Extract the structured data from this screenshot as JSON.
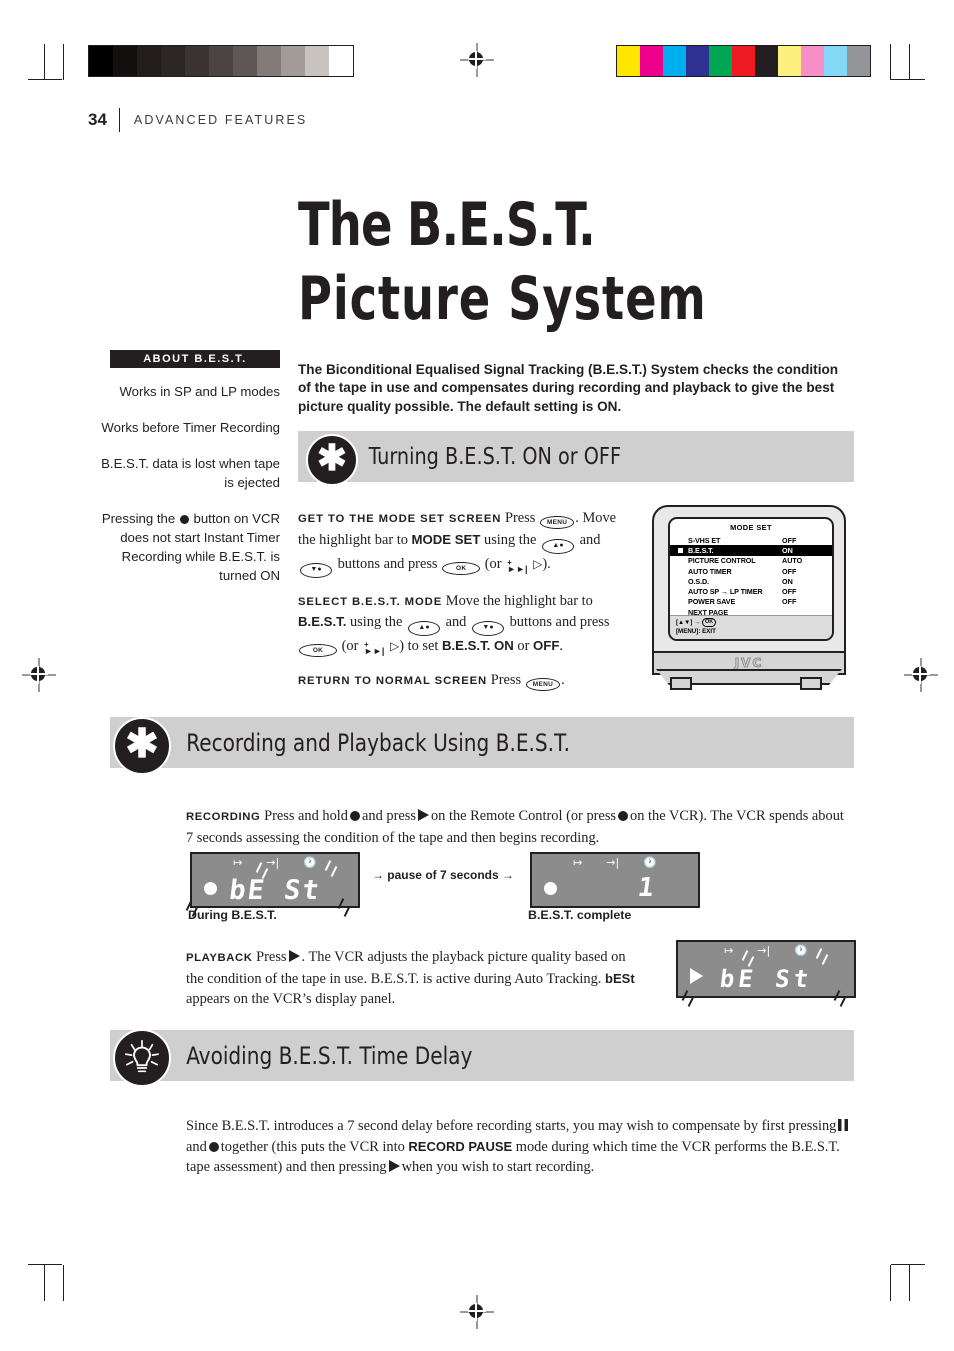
{
  "page": {
    "number": "34",
    "section": "ADVANCED FEATURES",
    "title_line1": "The B.E.S.T.",
    "title_line2": "Picture System"
  },
  "calibration": {
    "grey_ramp": [
      "#000000",
      "#120f0e",
      "#221d1b",
      "#2c2725",
      "#3b3432",
      "#4c4442",
      "#5f5755",
      "#837b78",
      "#a39b98",
      "#c9c3c0",
      "#ffffff"
    ],
    "color_patches": [
      "#ffe600",
      "#ec008c",
      "#00aeef",
      "#2e3192",
      "#00a651",
      "#ed1c24",
      "#231f20",
      "#fdf07f",
      "#f68fc5",
      "#82d8f5",
      "#939598"
    ]
  },
  "sidebar": {
    "heading": "ABOUT B.E.S.T.",
    "notes": [
      {
        "before": "Works in SP and LP modes",
        "after": ""
      },
      {
        "before": "Works before Timer Recording",
        "after": ""
      },
      {
        "before": "B.E.S.T. data is lost when tape is ejected",
        "after": ""
      },
      {
        "before": "Pressing the ",
        "after": " button on VCR does not start Instant Timer Recording while B.E.S.T. is turned ON"
      }
    ]
  },
  "intro": "The Biconditional Equalised Signal Tracking (B.E.S.T.) System checks the condition of the tape in use and compensates during recording and playback to give the best picture quality possible. The default setting is ON.",
  "sections": [
    {
      "id": "turning",
      "icon": "asterisk-badge-icon",
      "title": "Turning B.E.S.T. ON or OFF"
    },
    {
      "id": "recording",
      "icon": "asterisk-badge-icon",
      "title": "Recording and Playback Using B.E.S.T."
    },
    {
      "id": "avoiding",
      "icon": "lightbulb-badge-icon",
      "title": "Avoiding B.E.S.T. Time Delay"
    }
  ],
  "steps": {
    "step1": {
      "lead": "GET TO THE MODE SET SCREEN",
      "t1": "Press",
      "menu_key": "MENU",
      "t2": ". Move the highlight bar to",
      "bold1": "MODE SET",
      "t3": "using the",
      "updn_key_1": "▲●",
      "t4": "and",
      "updn_key_2": "▼●",
      "t5": "buttons and press",
      "ok_key": "OK",
      "t6": "(or",
      "skip_key": "►►|",
      "arrow": "▷",
      "t7": ")."
    },
    "step2": {
      "lead": "SELECT B.E.S.T. MODE",
      "t1": "Move the highlight bar to",
      "bold1": "B.E.S.T.",
      "t2": "using the",
      "updn_key_1": "▲●",
      "t3": "and",
      "updn_key_2": "▼●",
      "t4": "buttons and press",
      "ok_key": "OK",
      "t5": "(or",
      "skip_key": "►►|",
      "arrow": "▷",
      "t6": ") to set",
      "bold2": "B.E.S.T. ON",
      "t7": "or",
      "bold3": "OFF",
      "t8": "."
    },
    "step3": {
      "lead": "RETURN TO NORMAL SCREEN",
      "t1": "Press",
      "menu_key": "MENU",
      "t2": "."
    }
  },
  "osd": {
    "title": "MODE SET",
    "rows": [
      {
        "label": "S-VHS ET",
        "value": "OFF",
        "selected": false
      },
      {
        "label": "B.E.S.T.",
        "value": "ON",
        "selected": true
      },
      {
        "label": "PICTURE CONTROL",
        "value": "AUTO",
        "selected": false
      },
      {
        "label": "AUTO TIMER",
        "value": "OFF",
        "selected": false
      },
      {
        "label": "O.S.D.",
        "value": "ON",
        "selected": false
      },
      {
        "label": "AUTO SP → LP TIMER",
        "value": "OFF",
        "selected": false
      },
      {
        "label": "POWER SAVE",
        "value": "OFF",
        "selected": false
      },
      {
        "label": "NEXT PAGE",
        "value": "",
        "selected": false
      }
    ],
    "footer_line1_pre": "[▲▼] →",
    "footer_ok": "OK",
    "footer_line2": "[MENU]: EXIT",
    "brand": "JVC"
  },
  "recording": {
    "lead": "RECORDING",
    "t1": "Press and hold",
    "t2": "and press",
    "t3": "on the Remote Control (or press",
    "t4": "on the VCR). The VCR spends about 7 seconds assessing the condition of the tape and then begins recording."
  },
  "displays": {
    "during": {
      "text": "bE St",
      "caption": "During B.E.S.T."
    },
    "complete": {
      "text": "1",
      "caption": "B.E.S.T. complete"
    },
    "playback": {
      "text": "bE St"
    },
    "pause_note": "→ pause of 7 seconds →"
  },
  "playback": {
    "lead": "PLAYBACK",
    "t1": "Press",
    "t2": ". The VCR adjusts the playback picture quality based on the condition of the tape in use. B.E.S.T. is active during Auto Tracking.",
    "bold1": "bESt",
    "t3": "appears on the VCR’s display panel."
  },
  "delay": {
    "t1": "Since B.E.S.T. introduces a 7 second delay before recording starts, you may wish to compensate by first pressing",
    "t2": "and",
    "t3": "together (this puts the VCR into",
    "bold1": "RECORD PAUSE",
    "t4": "mode during which time the VCR performs the B.E.S.T. tape assessment) and then pressing",
    "t5": "when you wish to start recording."
  }
}
